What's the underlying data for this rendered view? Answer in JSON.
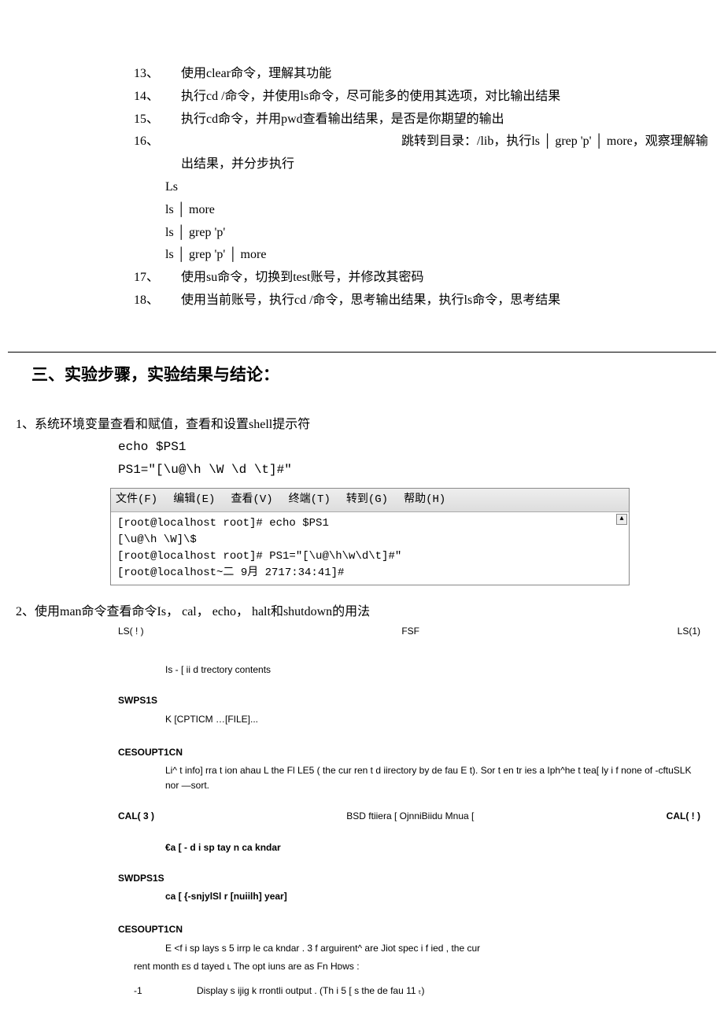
{
  "tasks": {
    "i13_num": "13、",
    "i13_text": "使用clear命令，理解其功能",
    "i14_num": "14、",
    "i14_text": "执行cd /命令，并使用ls命令，尽可能多的使用其选项，对比输出结果",
    "i15_num": "15、",
    "i15_text": "执行cd命令，并用pwd查看输出结果，是否是你期望的输出",
    "i16_num": "16、",
    "i16_text_a": "",
    "i16_text_b": "跳转到目录：/lib，执行ls │ grep  'p' │ more，观察理解输出结果，并分步执行",
    "i16_l1": "Ls",
    "i16_l2": "ls │ more",
    "i16_l3": "ls │ grep  'p'",
    "i16_l4": "ls │ grep  'p' │ more",
    "i17_num": "17、",
    "i17_text": "使用su命令，切换到test账号，并修改其密码",
    "i18_num": "18、",
    "i18_text": "使用当前账号，执行cd /命令，思考输出结果，执行ls命令，思考结果"
  },
  "section_title": "三、实验步骤，实验结果与结论：",
  "step1": {
    "title": "1、系统环境变量查看和赋值，查看和设置shell提示符",
    "code1": "echo $PS1",
    "code2": "PS1=\"[\\u@\\h \\W \\d \\t]#\""
  },
  "terminal": {
    "menu_file": "文件(F)",
    "menu_edit": "编辑(E)",
    "menu_view": "查看(V)",
    "menu_term": "终端(T)",
    "menu_go": "转到(G)",
    "menu_help": "帮助(H)",
    "l1": "[root@localhost root]# echo $PS1",
    "l2": "[\\u@\\h \\W]\\$",
    "l3": "[root@localhost root]# PS1=\"[\\u@\\h\\w\\d\\t]#\"",
    "l4": "[root@localhost~二  9月 2717:34:41]#",
    "scroll": "▴"
  },
  "step2": {
    "title": "2、使用man命令查看命令Is，  cal，  echo，  halt和shutdown的用法"
  },
  "man_ls": {
    "left": "LS( ! )",
    "center": "FSF",
    "right": "LS(1)",
    "name": "Is - [ ii d trectory contents",
    "syn_label": "SWPS1S",
    "syn_text": "K [CPTICM …[FILE]...",
    "desc_label": "CESOUPT1CN",
    "desc_text": "Li^ t info] rra t ion ahau L the Fl LE5 ( the cur ren t d iirectory by de fau E t). Sor t en tr ies a Iph^he t tea[ ly i f none of -cftuSLK nor —sort."
  },
  "man_cal": {
    "left": "CAL( 3 )",
    "center": "BSD ftiiera [ OjnniBiidu Mnua [",
    "right": "CAL( ! )",
    "name": "€a [ - d i sp tay n ca kndar",
    "syn_label": "SWDPS1S",
    "syn_text": "ca [ {-snjylSl r [nuiilh] year]",
    "desc_label": "CESOUPT1CN",
    "desc_l1": "E <f i sp lays s 5 irrp le ca kndar .               3 f arguirent^ are Jiot spec i f ied , the cur",
    "desc_l2": "rent month ᴇs d tayed ʟ The opt iuns are as Fn Hᴅws :",
    "opt_flag": "-1",
    "opt_text": "Display s ijig k rrontli output . (Th i 5 [ s the de fau 11 ₜ)"
  }
}
